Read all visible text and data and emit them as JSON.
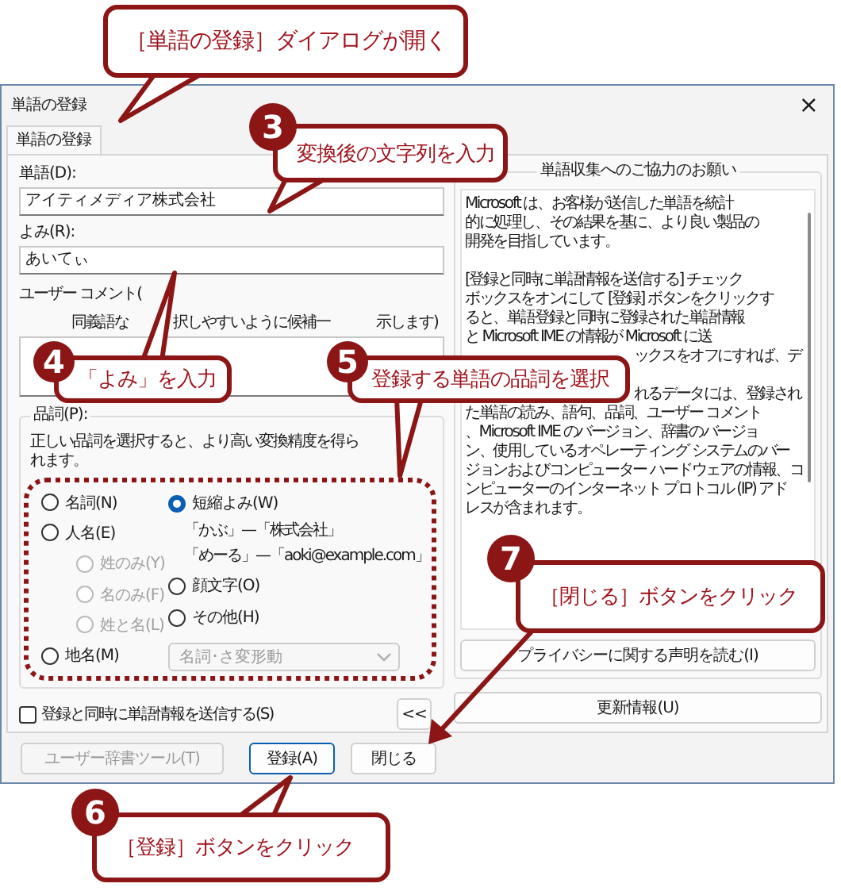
{
  "callouts": [
    {
      "kind": "banner",
      "text": "［単語の登録］ダイアログが開く"
    },
    {
      "kind": "step",
      "number": "3",
      "text": "変換後の文字列を入力"
    },
    {
      "kind": "step",
      "number": "4",
      "text": "「よみ」を入力"
    },
    {
      "kind": "step",
      "number": "5",
      "text": "登録する単語の品詞を選択"
    },
    {
      "kind": "step",
      "number": "7",
      "text": "［閉じる］ボタンをクリック"
    },
    {
      "kind": "step",
      "number": "6",
      "text": "［登録］ボタンをクリック"
    }
  ],
  "window": {
    "title": "単語の登録",
    "close": "×"
  },
  "tabs": [
    {
      "label": "単語の登録",
      "selected": true
    }
  ],
  "word": {
    "label": "単語(D):",
    "value": "アイティメディア株式会社"
  },
  "reading": {
    "label": "よみ(R):",
    "value": "あいてぃ"
  },
  "comment": {
    "label": "ユーザー コメント(",
    "hint_fragments": [
      "同義語な",
      "択しやすいように候補一",
      "示します)"
    ]
  },
  "part_of_speech": {
    "label": "品詞(P):",
    "note": "正しい品詞を選択すると、より高い変換精度を得られます。",
    "options_left": [
      {
        "kind": "radio",
        "label": "名詞(N)",
        "selected": false,
        "disabled": false
      },
      {
        "kind": "radio",
        "label": "人名(E)",
        "selected": false,
        "disabled": false
      },
      {
        "kind": "sub",
        "label": "姓のみ(Y)",
        "selected": false,
        "disabled": true
      },
      {
        "kind": "sub",
        "label": "名のみ(F)",
        "selected": false,
        "disabled": true
      },
      {
        "kind": "sub",
        "label": "姓と名(L)",
        "selected": false,
        "disabled": true
      },
      {
        "kind": "radio",
        "label": "地名(M)",
        "selected": false,
        "disabled": false
      }
    ],
    "options_right": [
      {
        "kind": "radio",
        "label": "短縮よみ(W)",
        "selected": true,
        "disabled": false
      },
      {
        "kind": "example",
        "label": "「かぶ」—「株式会社」"
      },
      {
        "kind": "example",
        "label": "「めーる」—「aoki@example.com」"
      },
      {
        "kind": "radio",
        "label": "顔文字(O)",
        "selected": false,
        "disabled": false
      },
      {
        "kind": "radio",
        "label": "その他(H)",
        "selected": false,
        "disabled": false
      },
      {
        "kind": "dropdown",
        "label": "名詞･さ変形動",
        "disabled": true
      }
    ]
  },
  "send_checkbox": {
    "label": "登録と同時に単語情報を送信する(S)",
    "checked": false
  },
  "collapse_button": "<<",
  "info_panel": {
    "title": "単語収集へのご協力のお願い",
    "paragraphs": [
      [
        {
          "text": "Microsoft は、お客様が送信した単語を統計",
          "kind": "full"
        },
        {
          "text": "的に処理し、その結果を基に、より良い製品の",
          "kind": "full"
        },
        {
          "text": "開発を目指しています。",
          "kind": "full"
        }
      ],
      [
        {
          "text": "[登録と同時に単語情報を送信する] チェック",
          "kind": "full"
        },
        {
          "text": "ボックスをオンにして [登録] ボタンをクリックす",
          "kind": "full"
        },
        {
          "text": "ると、単語登録と同時に登録された単語情報",
          "kind": "full"
        },
        {
          "text": "と Microsoft IME の情報が Microsoft に送",
          "kind": "full"
        },
        {
          "text": "ックスをオフにすれば、デ",
          "kind": "fragment"
        }
      ],
      [
        {
          "text": "れるデータには、登録され",
          "kind": "fragment"
        },
        {
          "text": "た単語の読み、語句、品詞、ユーザー コメント",
          "kind": "full"
        },
        {
          "text": "、Microsoft IME のバージョン、辞書のバージョ",
          "kind": "full"
        },
        {
          "text": "ン、使用しているオペレーティング システムのバー",
          "kind": "full"
        },
        {
          "text": "ジョンおよびコンピューター ハードウェアの情報、コ",
          "kind": "full"
        },
        {
          "text": "ンピューターのインターネット プロトコル (IP) アド",
          "kind": "full"
        },
        {
          "text": "レスが含まれます。",
          "kind": "full"
        }
      ]
    ],
    "privacy_button": "プライバシーに関する声明を読む(I)"
  },
  "update_button": "更新情報(U)",
  "buttons": [
    {
      "label": "ユーザー辞書ツール(T)",
      "disabled": true,
      "default": false
    },
    {
      "label": "登録(A)",
      "disabled": false,
      "default": true
    },
    {
      "label": "閉じる",
      "disabled": false,
      "default": false
    }
  ]
}
